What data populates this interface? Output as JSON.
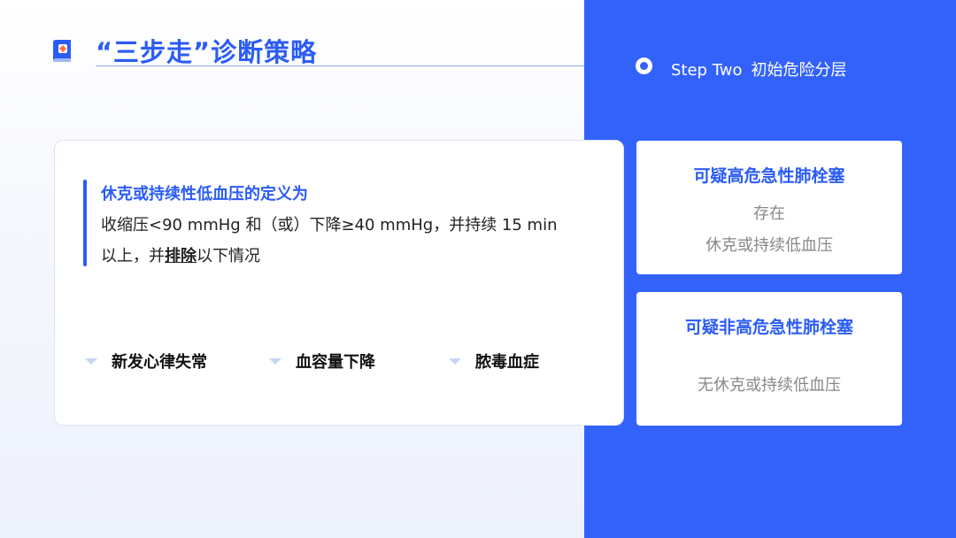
{
  "header": {
    "title": "“三步走”诊断策略"
  },
  "step": {
    "label": "Step Two",
    "name": "初始危险分层"
  },
  "definition": {
    "title": "休克或持续性低血压的定义为",
    "line1": "收缩压<90 mmHg 和（或）下降≥40 mmHg，并持续 15 min",
    "line2_prefix": "以上，并",
    "line2_emphasis": "排除",
    "line2_suffix": "以下情况"
  },
  "exclusions": [
    "新发心律失常",
    "血容量下降",
    "脓毒血症"
  ],
  "high_risk": {
    "title": "可疑高危急性肺栓塞",
    "line1": "存在",
    "line2": "休克或持续低血压"
  },
  "non_high_risk": {
    "title": "可疑非高危急性肺栓塞",
    "line1": "无休克或持续低血压"
  },
  "colors": {
    "accent": "#2b5cf5",
    "panel": "#3362fb"
  },
  "icons": {
    "logo": "medical-book-logo",
    "step_marker": "radio-dot-icon",
    "bullet": "triangle-down-icon"
  }
}
